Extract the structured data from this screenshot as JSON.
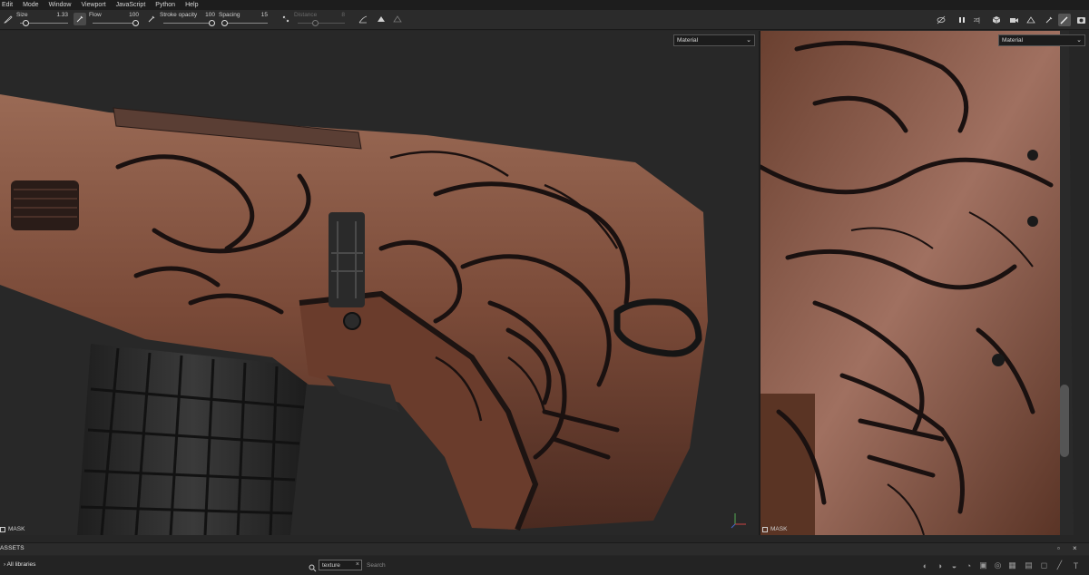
{
  "menu": [
    "Edit",
    "Mode",
    "Window",
    "Viewport",
    "JavaScript",
    "Python",
    "Help"
  ],
  "toolbar": {
    "params": [
      {
        "label": "Size",
        "value": "1.33",
        "fraction": 0.03
      },
      {
        "label": "Flow",
        "value": "100",
        "fraction": 1.0
      },
      {
        "label": "Stroke opacity",
        "value": "100",
        "fraction": 1.0
      },
      {
        "label": "Spacing",
        "value": "15",
        "fraction": 0.03
      },
      {
        "label": "Distance",
        "value": "8",
        "fraction": 0.35,
        "disabled": true
      }
    ]
  },
  "viewport3d": {
    "material_select": "Material",
    "mask_label": "MASK"
  },
  "viewport2d": {
    "material_select": "Material",
    "mask_label": "MASK"
  },
  "assets": {
    "title": "ASSETS"
  },
  "library": {
    "item": "All libraries",
    "search_chip": "texture",
    "search_placeholder": "Search"
  },
  "colors": {
    "copper": "#8a5a42",
    "engraving": "#1a1110",
    "background": "#282828"
  },
  "icons": [
    "brush-tool-icon",
    "eraser-icon",
    "symmetry-icon",
    "pause-icon",
    "camera-icon",
    "screenshot-icon",
    "search-icon",
    "close-icon"
  ]
}
